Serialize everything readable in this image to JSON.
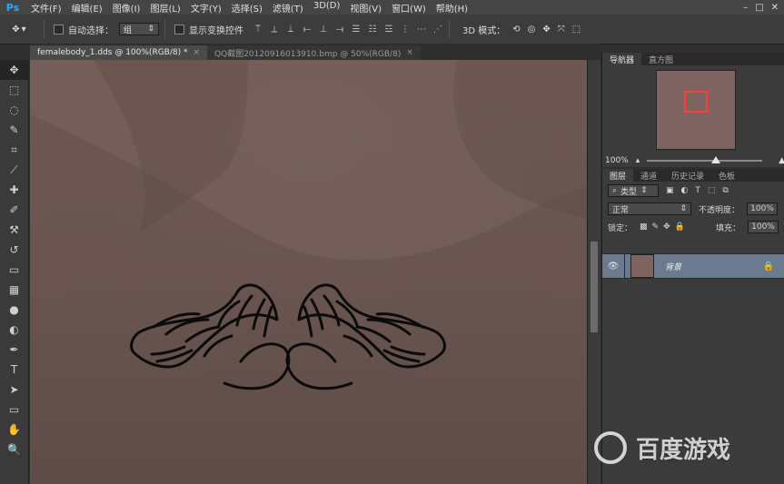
{
  "app": {
    "logo": "Ps",
    "menu": [
      "文件(F)",
      "编辑(E)",
      "图像(I)",
      "图层(L)",
      "文字(Y)",
      "选择(S)",
      "滤镜(T)",
      "3D(D)",
      "视图(V)",
      "窗口(W)",
      "帮助(H)"
    ],
    "window_controls": [
      "–",
      "□",
      "✕"
    ]
  },
  "options": {
    "auto_select_label": "自动选择：",
    "auto_select_value": "组",
    "show_transform_label": "显示变换控件",
    "mode_3d_label": "3D 模式：",
    "icons": [
      "move-tool-icon",
      "align-top-icon",
      "align-vcenter-icon",
      "align-bottom-icon",
      "align-left-icon",
      "align-hcenter-icon",
      "align-right-icon",
      "distribute-icons"
    ]
  },
  "tabs": [
    {
      "title": "femalebody_1.dds @ 100%(RGB/8) *",
      "active": true
    },
    {
      "title": "QQ截图20120916013910.bmp @ 50%(RGB/8)",
      "active": false
    }
  ],
  "tools": [
    {
      "name": "move-tool",
      "glyph": "✥",
      "active": true
    },
    {
      "name": "marquee-tool",
      "glyph": "⬚"
    },
    {
      "name": "lasso-tool",
      "glyph": "◌"
    },
    {
      "name": "quick-selection-tool",
      "glyph": "✎"
    },
    {
      "name": "crop-tool",
      "glyph": "⌗"
    },
    {
      "name": "eyedropper-tool",
      "glyph": "⟋"
    },
    {
      "name": "spot-healing-tool",
      "glyph": "✚"
    },
    {
      "name": "brush-tool",
      "glyph": "✐"
    },
    {
      "name": "clone-stamp-tool",
      "glyph": "⚒"
    },
    {
      "name": "history-brush-tool",
      "glyph": "↺"
    },
    {
      "name": "eraser-tool",
      "glyph": "▭"
    },
    {
      "name": "gradient-tool",
      "glyph": "▦"
    },
    {
      "name": "blur-tool",
      "glyph": "●"
    },
    {
      "name": "dodge-tool",
      "glyph": "◐"
    },
    {
      "name": "pen-tool",
      "glyph": "✒"
    },
    {
      "name": "type-tool",
      "glyph": "T"
    },
    {
      "name": "path-selection-tool",
      "glyph": "➤"
    },
    {
      "name": "shape-tool",
      "glyph": "▭"
    },
    {
      "name": "hand-tool",
      "glyph": "✋"
    },
    {
      "name": "zoom-tool",
      "glyph": "🔍"
    }
  ],
  "navigator": {
    "tabs": [
      "导航器",
      "直方图"
    ],
    "zoom_label": "100%",
    "zoom_fraction": 0.6
  },
  "layers": {
    "tabs": [
      "图层",
      "通道",
      "历史记录",
      "色板"
    ],
    "filter_label": "类型",
    "blend_mode": "正常",
    "opacity_label": "不透明度：",
    "opacity_value": "100%",
    "lock_label": "锁定：",
    "fill_label": "填充：",
    "fill_value": "100%",
    "items": [
      {
        "name": "背景",
        "locked": true
      }
    ]
  },
  "watermark": {
    "text": "百度游戏"
  },
  "colors": {
    "skin_base": "#6a5550",
    "shadow": "#5b4843",
    "highlight": "#7a6560",
    "selection_blue": "#6b7a8f"
  }
}
